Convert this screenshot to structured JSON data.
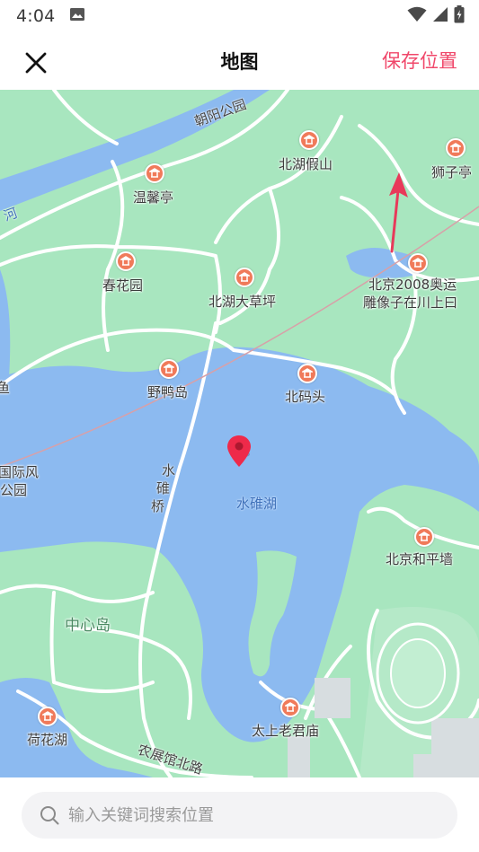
{
  "status_bar": {
    "time": "4:04",
    "icons": [
      "image-icon",
      "wifi-icon",
      "signal-icon",
      "battery-icon"
    ]
  },
  "app_bar": {
    "title": "地图",
    "save_label": "保存位置",
    "close_icon": "close-icon"
  },
  "colors": {
    "accent": "#f0476a",
    "park_green": "#a8e6bf",
    "water_blue": "#8cbaf0",
    "poi_orange": "#f07a5a"
  },
  "map": {
    "road_labels": {
      "chaoyang_park_road": "朝阳公园",
      "river": "河",
      "shuiduan_bridge": [
        "水",
        "碓",
        "桥"
      ],
      "nongzhan_road": "农展馆北路"
    },
    "places": {
      "beihu_jiashan": "北湖假山",
      "shizi_ting": "狮子亭",
      "wenxin_ting": "温馨亭",
      "chunhua_yuan": "春花园",
      "beihu_dacaoping": "北湖大草坪",
      "olympic_sculpture_line1": "北京2008奥运",
      "olympic_sculpture_line2": "雕像子在川上曰",
      "yeya_dao": "野鸭岛",
      "beima_tou": "北码头",
      "guojifeng_line1": "国际风",
      "guojifeng_line2": "公园",
      "shuiduan_hu": "水碓湖",
      "beijing_heping_qiang": "北京和平墙",
      "zhongxin_dao": "中心岛",
      "hehua_hu": "荷花湖",
      "taishang_laojun_miao": "太上老君庙",
      "edge_left": "鱼"
    },
    "marker_icon": "map-pin-icon"
  },
  "search": {
    "placeholder": "输入关键词搜索位置",
    "value": ""
  }
}
